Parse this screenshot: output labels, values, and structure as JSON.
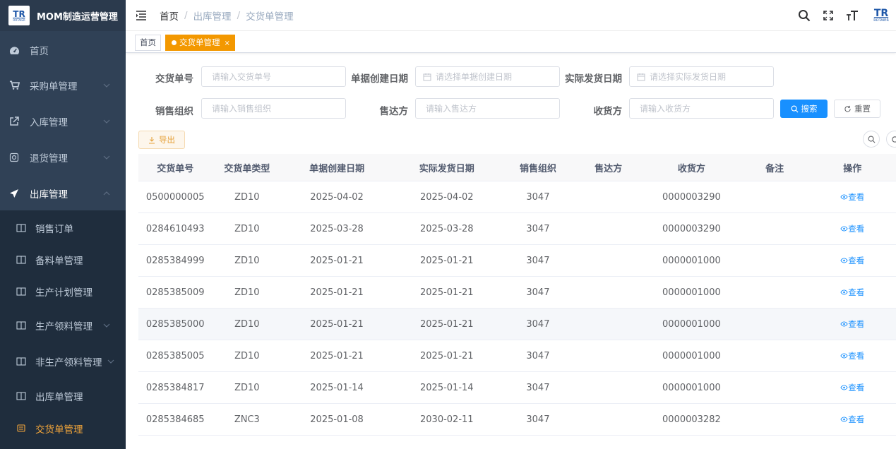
{
  "app": {
    "title": "MOM制造运营管理",
    "logo_text": "TR",
    "logo_sub": "ROTAIER"
  },
  "sidebar": {
    "items": [
      {
        "label": "首页",
        "icon": "dashboard-icon"
      },
      {
        "label": "采购单管理",
        "icon": "cart-icon"
      },
      {
        "label": "入库管理",
        "icon": "external-link-icon"
      },
      {
        "label": "退货管理",
        "icon": "return-icon"
      },
      {
        "label": "出库管理",
        "icon": "send-icon"
      }
    ],
    "sub_items": [
      {
        "label": "销售订单"
      },
      {
        "label": "备料单管理"
      },
      {
        "label": "生产计划管理"
      },
      {
        "label": "生产领料管理"
      },
      {
        "label": "非生产领料管理"
      },
      {
        "label": "出库单管理"
      },
      {
        "label": "交货单管理"
      }
    ]
  },
  "breadcrumb": {
    "home": "首页",
    "sep": "/",
    "level1": "出库管理",
    "level2": "交货单管理"
  },
  "tags": {
    "home": "首页",
    "active": "交货单管理",
    "close": "×"
  },
  "search": {
    "delivery_no_label": "交货单号",
    "delivery_no_placeholder": "请输入交货单号",
    "create_date_label": "单据创建日期",
    "create_date_placeholder": "请选择单据创建日期",
    "ship_date_label": "实际发货日期",
    "ship_date_placeholder": "请选择实际发货日期",
    "sales_org_label": "销售组织",
    "sales_org_placeholder": "请输入销售组织",
    "sold_to_label": "售达方",
    "sold_to_placeholder": "请输入售达方",
    "ship_to_label": "收货方",
    "ship_to_placeholder": "请输入收货方",
    "search_button": "搜索",
    "reset_button": "重置"
  },
  "toolbar": {
    "export_button": "导出"
  },
  "table": {
    "headers": [
      "交货单号",
      "交货单类型",
      "单据创建日期",
      "实际发货日期",
      "销售组织",
      "售达方",
      "收货方",
      "备注",
      "操作"
    ],
    "view_label": "查看",
    "rows": [
      [
        "0500000005",
        "ZD10",
        "2025-04-02",
        "2025-04-02",
        "3047",
        "",
        "0000003290",
        ""
      ],
      [
        "0284610493",
        "ZD10",
        "2025-03-28",
        "2025-03-28",
        "3047",
        "",
        "0000003290",
        ""
      ],
      [
        "0285384999",
        "ZD10",
        "2025-01-21",
        "2025-01-21",
        "3047",
        "",
        "0000001000",
        ""
      ],
      [
        "0285385009",
        "ZD10",
        "2025-01-21",
        "2025-01-21",
        "3047",
        "",
        "0000001000",
        ""
      ],
      [
        "0285385000",
        "ZD10",
        "2025-01-21",
        "2025-01-21",
        "3047",
        "",
        "0000001000",
        ""
      ],
      [
        "0285385005",
        "ZD10",
        "2025-01-21",
        "2025-01-21",
        "3047",
        "",
        "0000001000",
        ""
      ],
      [
        "0285384817",
        "ZD10",
        "2025-01-14",
        "2025-01-14",
        "3047",
        "",
        "0000001000",
        ""
      ],
      [
        "0285384685",
        "ZNC3",
        "2025-01-08",
        "2030-02-11",
        "3047",
        "",
        "0000003282",
        ""
      ]
    ]
  },
  "colors": {
    "sidebar_bg": "#304156",
    "submenu_bg": "#1f2d3d",
    "accent": "#f39800",
    "primary": "#1890ff"
  }
}
